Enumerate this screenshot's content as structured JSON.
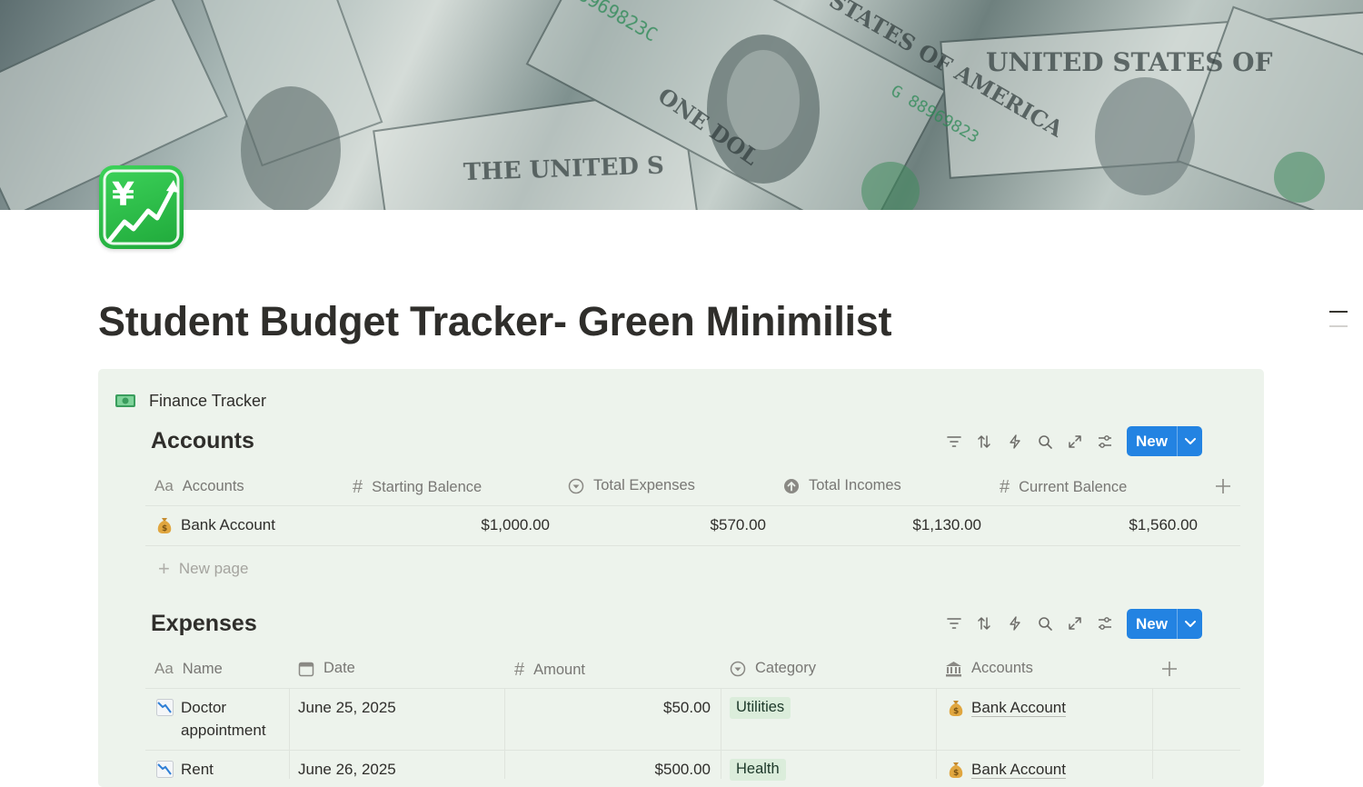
{
  "page": {
    "title": "Student Budget Tracker- Green Minimilist",
    "icon": "chart-increasing-with-yen-icon",
    "cover": "us-dollar-bills-cover-image"
  },
  "callout": {
    "icon": "banknote-icon",
    "title": "Finance Tracker",
    "background": "#edf3ec"
  },
  "accounts_db": {
    "title": "Accounts",
    "new_label": "New",
    "columns": [
      {
        "icon": "title-aa-icon",
        "label": "Accounts"
      },
      {
        "icon": "number-hash-icon",
        "label": "Starting Balence"
      },
      {
        "icon": "rollup-icon",
        "label": "Total Expenses"
      },
      {
        "icon": "rollup-up-icon",
        "label": "Total Incomes"
      },
      {
        "icon": "number-hash-icon",
        "label": "Current Balence"
      }
    ],
    "rows": [
      {
        "icon": "money-bag-icon",
        "name": "Bank Account",
        "starting": "$1,000.00",
        "expenses": "$570.00",
        "incomes": "$1,130.00",
        "current": "$1,560.00"
      }
    ],
    "new_page_label": "New page"
  },
  "expenses_db": {
    "title": "Expenses",
    "new_label": "New",
    "columns": [
      {
        "icon": "title-aa-icon",
        "label": "Name"
      },
      {
        "icon": "calendar-icon",
        "label": "Date"
      },
      {
        "icon": "number-hash-icon",
        "label": "Amount"
      },
      {
        "icon": "select-icon",
        "label": "Category"
      },
      {
        "icon": "bank-icon",
        "label": "Accounts"
      }
    ],
    "rows": [
      {
        "icon": "chart-decreasing-icon",
        "name_line1": "Doctor",
        "name_line2": "appointment",
        "date": "June 25, 2025",
        "amount": "$50.00",
        "category": "Utilities",
        "category_color": "#dbeddb",
        "account": "Bank Account"
      },
      {
        "icon": "chart-decreasing-icon",
        "name_line1": "Rent",
        "name_line2": "",
        "date": "June 26, 2025",
        "amount": "$500.00",
        "category": "Health",
        "category_color": "#dbeddb",
        "account": "Bank Account"
      }
    ]
  },
  "colors": {
    "accent": "#2383e2",
    "tag_green": "#dbeddb",
    "text": "#37352f",
    "muted": "#787774"
  }
}
